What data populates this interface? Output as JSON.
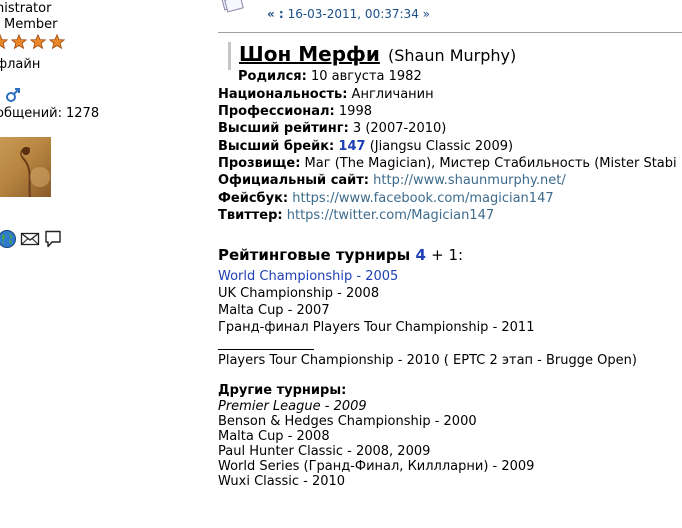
{
  "sidebar": {
    "role": "nistrator",
    "group": "Member",
    "stars": 4,
    "status": "флайн",
    "gender_icon": "male-symbol-icon",
    "posts_label": "общений:",
    "posts_value": "1278",
    "contact_icons": [
      "globe-icon",
      "envelope-icon",
      "speech-bubble-icon"
    ]
  },
  "post": {
    "date_prefix": "« :",
    "date": "16-03-2011, 00:37:34",
    "date_suffix": "»"
  },
  "profile": {
    "name_ru": "Шон Мерфи",
    "name_en": "(Shaun Murphy)",
    "born_label": "Родился:",
    "born_value": "10 августа 1982",
    "nationality_label": "Национальность:",
    "nationality_value": "Англичанин",
    "pro_label": "Профессионал:",
    "pro_value": "1998",
    "rank_label": "Высший рейтинг:",
    "rank_value": "3 (2007-2010)",
    "break_label": "Высший брейк:",
    "break_value": "147",
    "break_note": "(Jiangsu Classic 2009)",
    "nick_label": "Прозвище:",
    "nick_value": "Маг (The Magician), Мистер Стабильность (Mister Stabi",
    "site_label": "Официальный сайт:",
    "site_value": "http://www.shaunmurphy.net/",
    "fb_label": "Фейсбук:",
    "fb_value": "https://www.facebook.com/magician147",
    "tw_label": "Твиттер:",
    "tw_value": "https://twitter.com/Magician147"
  },
  "ranking": {
    "heading": "Рейтинговые турниры",
    "count": "4",
    "extra": "+ 1:",
    "titles": [
      "World Championship - 2005",
      "UK Championship - 2008",
      "Malta Cup - 2007",
      "Гранд-финал Players Tour Championship - 2011"
    ],
    "extra_title": "Players Tour Championship - 2010 ( EPTC 2 этап - Brugge Open)"
  },
  "other": {
    "heading": "Другие турниры:",
    "items": [
      "Premier League - 2009",
      "Benson & Hedges Championship - 2000",
      "Malta Cup - 2008",
      "Paul Hunter Classic - 2008, 2009",
      "World Series (Гранд-Финал, Киллларни) - 2009",
      "Wuxi Classic - 2010"
    ]
  },
  "colors": {
    "link_blue": "#1f3fb5",
    "url_color": "#3d6b8d",
    "star_fill": "#e8862a"
  }
}
